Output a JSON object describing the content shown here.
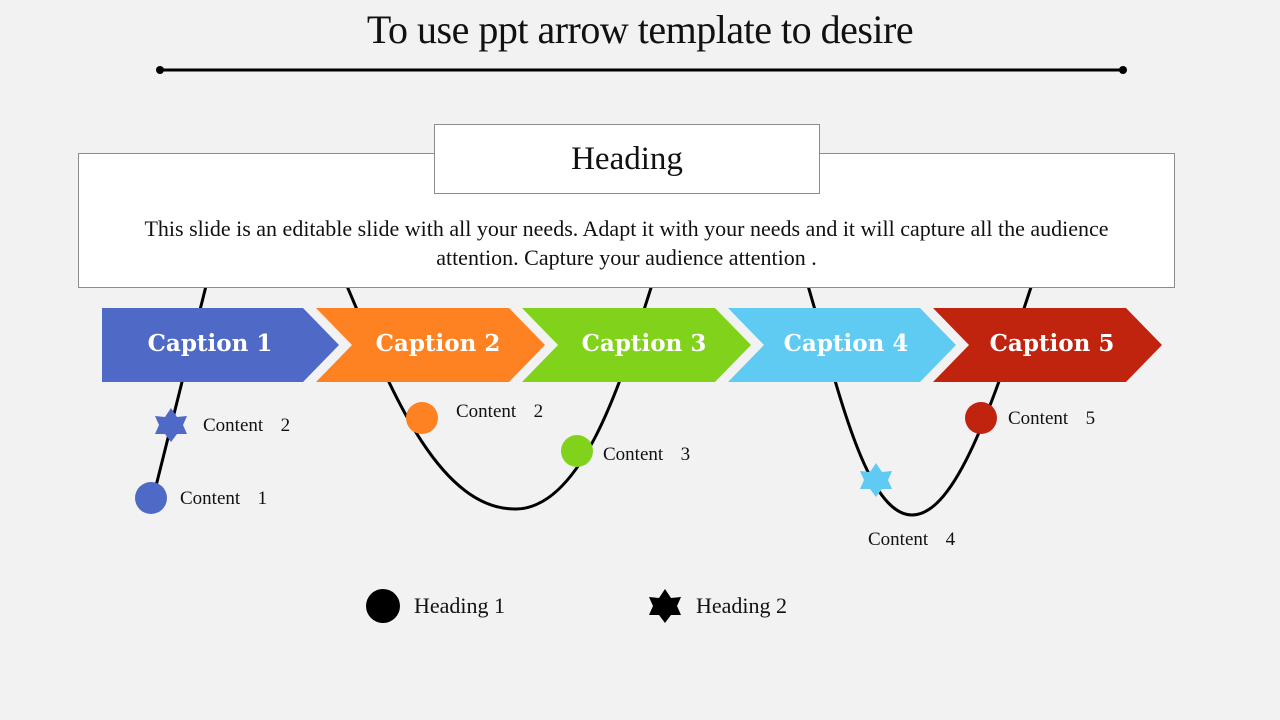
{
  "title": "To use ppt arrow template to desire",
  "heading": "Heading",
  "description": "This slide is an editable slide with all your needs. Adapt it with your needs and it will capture all the audience attention. Capture your audience attention .",
  "captions": [
    {
      "label": "Caption 1",
      "color": "#4f69c6"
    },
    {
      "label": "Caption 2",
      "color": "#fe8222"
    },
    {
      "label": "Caption 3",
      "color": "#81d21b"
    },
    {
      "label": "Caption 4",
      "color": "#5fcbf2"
    },
    {
      "label": "Caption 5",
      "color": "#c0240f"
    }
  ],
  "markers": [
    {
      "label": "Content  1",
      "shape": "circle",
      "color": "#4f69c6"
    },
    {
      "label": "Content  2",
      "shape": "star",
      "color": "#4f69c6"
    },
    {
      "label": "Content  2",
      "shape": "circle",
      "color": "#fe8222"
    },
    {
      "label": "Content  3",
      "shape": "circle",
      "color": "#81d21b"
    },
    {
      "label": "Content  4",
      "shape": "star",
      "color": "#5fcbf2"
    },
    {
      "label": "Content  5",
      "shape": "circle",
      "color": "#c0240f"
    }
  ],
  "legend": [
    {
      "label": "Heading 1",
      "shape": "circle",
      "color": "#000000"
    },
    {
      "label": "Heading 2",
      "shape": "star",
      "color": "#000000"
    }
  ]
}
